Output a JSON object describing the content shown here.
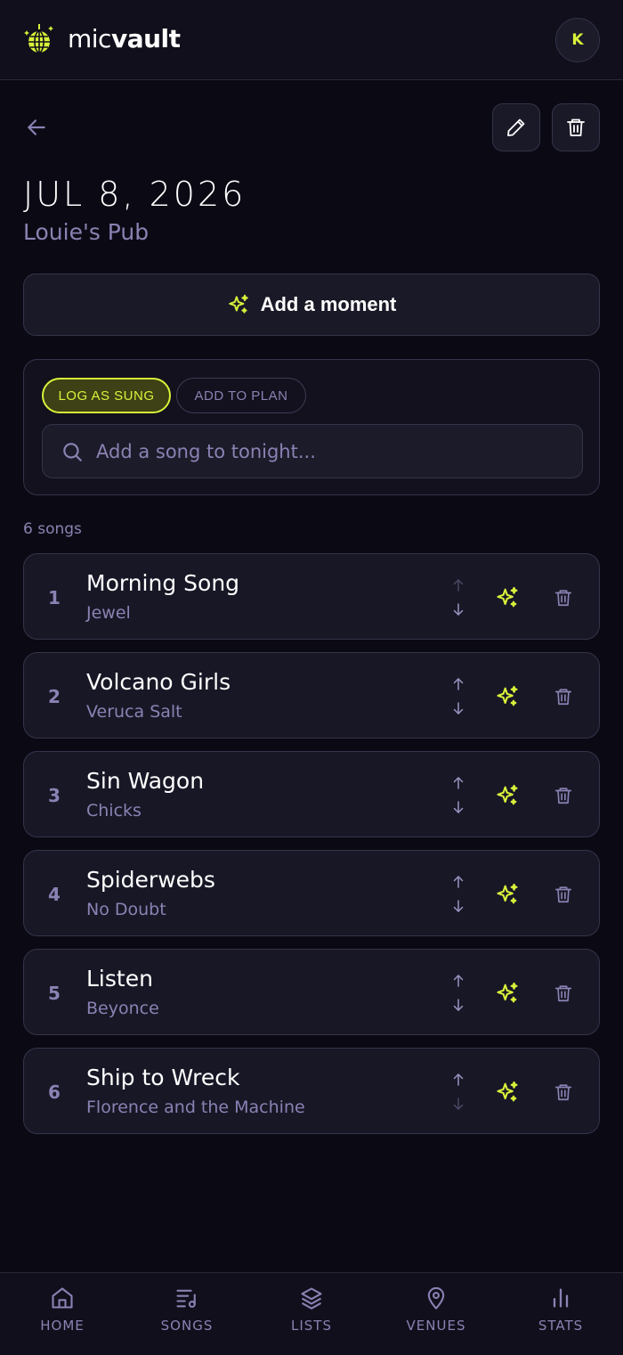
{
  "app": {
    "brand_light": "mic",
    "brand_bold": "vault",
    "avatar_initial": "K"
  },
  "night": {
    "date": "JUL 8, 2026",
    "venue": "Louie's Pub"
  },
  "actions": {
    "add_moment": "Add a moment"
  },
  "log": {
    "mode_log": "LOG AS SUNG",
    "mode_plan": "ADD TO PLAN",
    "selected_mode": "LOG AS SUNG",
    "search_placeholder": "Add a song to tonight..."
  },
  "songs": {
    "count_label": "6 songs",
    "items": [
      {
        "num": "1",
        "title": "Morning Song",
        "artist": "Jewel"
      },
      {
        "num": "2",
        "title": "Volcano Girls",
        "artist": "Veruca Salt"
      },
      {
        "num": "3",
        "title": "Sin Wagon",
        "artist": "Chicks"
      },
      {
        "num": "4",
        "title": "Spiderwebs",
        "artist": "No Doubt"
      },
      {
        "num": "5",
        "title": "Listen",
        "artist": "Beyonce"
      },
      {
        "num": "6",
        "title": "Ship to Wreck",
        "artist": "Florence and the Machine"
      }
    ]
  },
  "nav": {
    "home": "HOME",
    "songs": "SONGS",
    "lists": "LISTS",
    "venues": "VENUES",
    "stats": "STATS"
  },
  "colors": {
    "accent": "#d9f23a",
    "background": "#0b0a14",
    "muted_text": "#8a82b3",
    "card": "#181726",
    "border": "#35334a"
  },
  "icons": {
    "logo": "disco-ball-icon",
    "back": "arrow-left-icon",
    "edit": "pencil-icon",
    "delete": "trash-icon",
    "moment": "sparkles-icon",
    "search": "search-icon",
    "move_up": "arrow-up-icon",
    "move_down": "arrow-down-icon",
    "nav_home": "home-icon",
    "nav_songs": "music-list-icon",
    "nav_lists": "layers-icon",
    "nav_venues": "map-pin-icon",
    "nav_stats": "bar-chart-icon"
  }
}
